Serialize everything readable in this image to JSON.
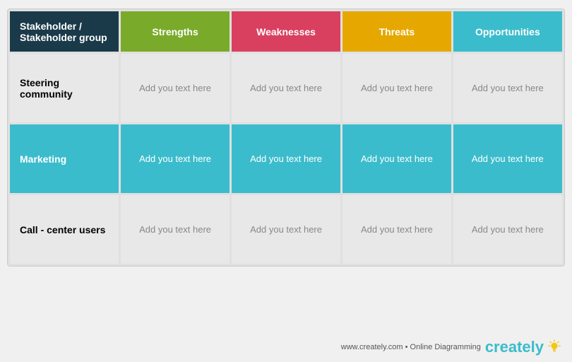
{
  "header": {
    "stakeholder_label": "Stakeholder / Stakeholder group",
    "strengths_label": "Strengths",
    "weaknesses_label": "Weaknesses",
    "threats_label": "Threats",
    "opportunities_label": "Opportunities"
  },
  "rows": [
    {
      "id": "row1",
      "stakeholder": "Steering community",
      "cells": [
        "Add you text here",
        "Add you text here",
        "Add you text here",
        "Add you text here"
      ]
    },
    {
      "id": "row2",
      "stakeholder": "Marketing",
      "cells": [
        "Add you text here",
        "Add you text here",
        "Add you text here",
        "Add you text here"
      ]
    },
    {
      "id": "row3",
      "stakeholder": "Call - center users",
      "cells": [
        "Add you text here",
        "Add you text here",
        "Add you text here",
        "Add you text here"
      ]
    }
  ],
  "footer": {
    "url": "www.creately.com • Online Diagramming",
    "brand": "creately"
  },
  "colors": {
    "header_stakeholder": "#1a3a4a",
    "header_strengths": "#7aaa2a",
    "header_weaknesses": "#d94060",
    "header_threats": "#e6a800",
    "header_opportunities": "#3bbccc",
    "row_light": "#e8e8e8",
    "row_teal": "#3bbccc"
  }
}
